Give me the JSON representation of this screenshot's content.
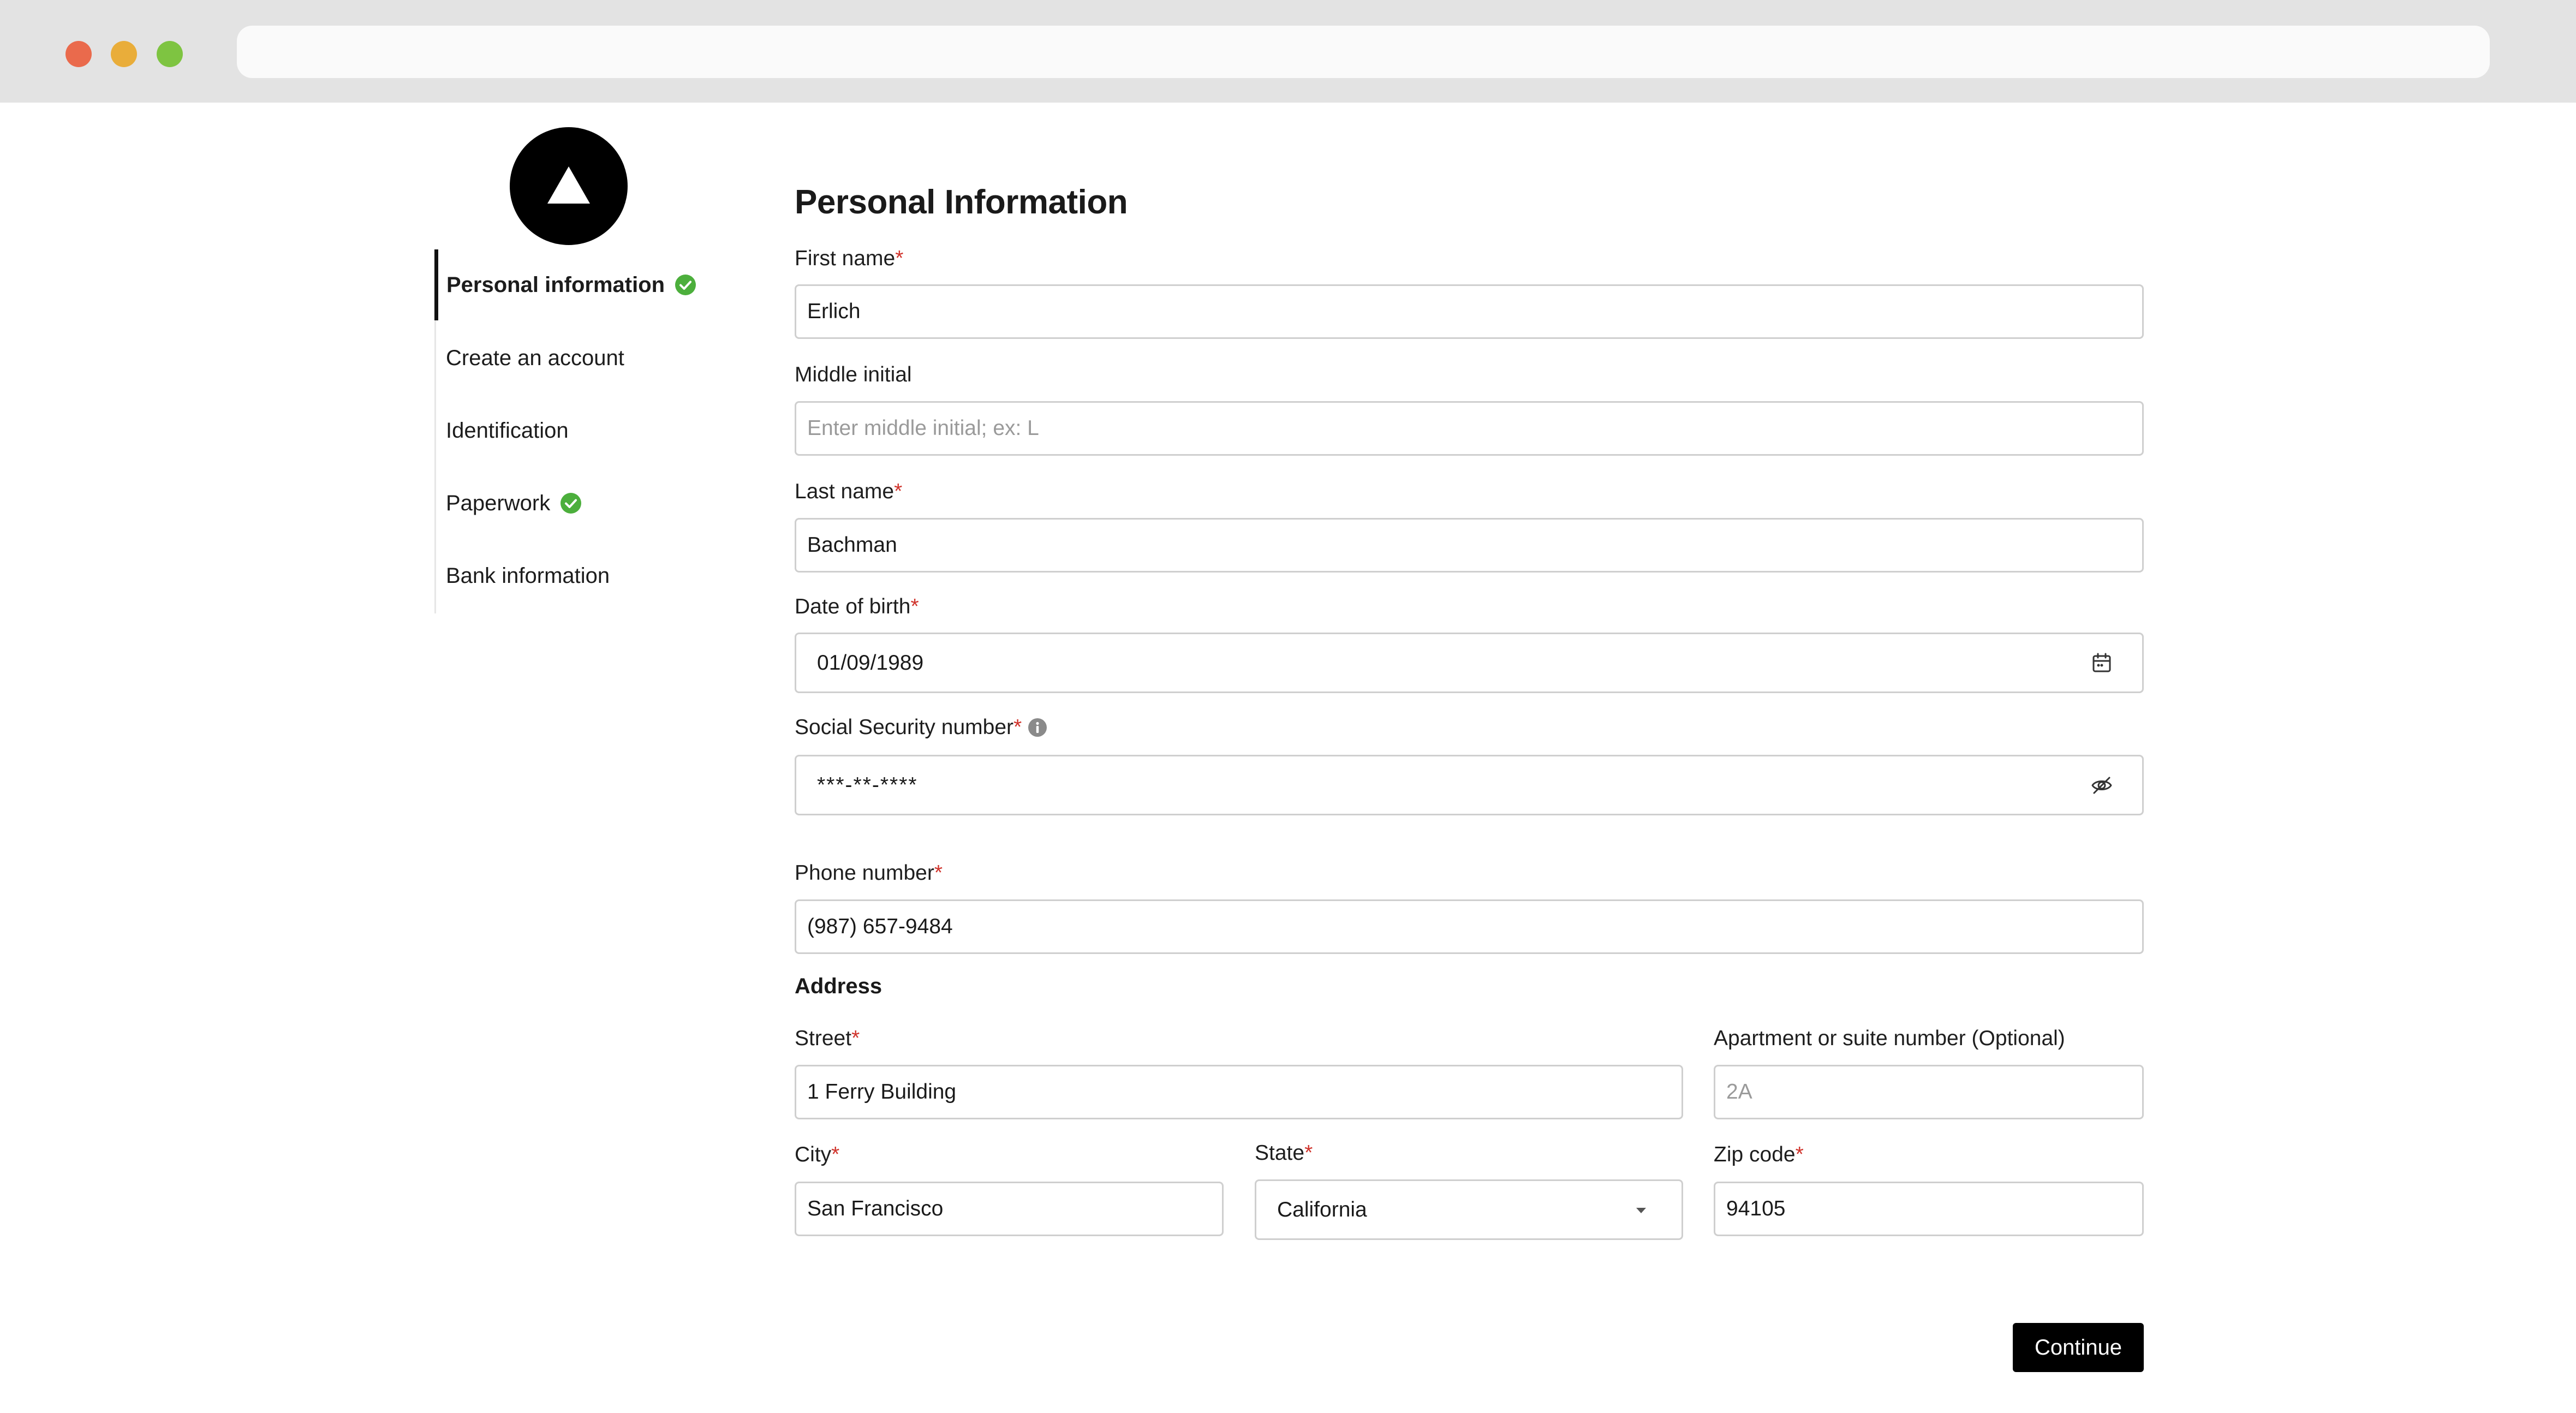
{
  "brand": {
    "logo_icon": "triangle-logo-icon"
  },
  "steps": [
    {
      "label": "Personal information",
      "completed": true,
      "active": true
    },
    {
      "label": "Create an account",
      "completed": false,
      "active": false
    },
    {
      "label": "Identification",
      "completed": false,
      "active": false
    },
    {
      "label": "Paperwork",
      "completed": true,
      "active": false
    },
    {
      "label": "Bank information",
      "completed": false,
      "active": false
    }
  ],
  "form": {
    "title": "Personal Information",
    "required_mark": "*",
    "first_name": {
      "label": "First name",
      "value": "Erlich"
    },
    "middle_initial": {
      "label": "Middle initial",
      "placeholder": "Enter middle initial; ex: L"
    },
    "last_name": {
      "label": "Last name",
      "value": "Bachman"
    },
    "dob": {
      "label": "Date of birth",
      "value": "01/09/1989",
      "icon": "calendar-icon"
    },
    "ssn": {
      "label": "Social Security number",
      "value": "***-**-****",
      "info_icon": "info-icon",
      "toggle_icon": "eye-off-icon"
    },
    "phone": {
      "label": "Phone number",
      "value": "(987) 657-9484"
    },
    "address": {
      "title": "Address",
      "street": {
        "label": "Street",
        "value": "1 Ferry Building"
      },
      "apartment": {
        "label": "Apartment or suite number (Optional)",
        "placeholder": "2A"
      },
      "city": {
        "label": "City",
        "value": "San Francisco"
      },
      "state": {
        "label": "State",
        "value": "California",
        "icon": "caret-down-icon"
      },
      "zip": {
        "label": "Zip code",
        "value": "94105"
      }
    },
    "continue_label": "Continue"
  },
  "colors": {
    "accent": "#000000",
    "success": "#4caf3c",
    "required": "#d0342c",
    "border": "#cfcfcf"
  }
}
